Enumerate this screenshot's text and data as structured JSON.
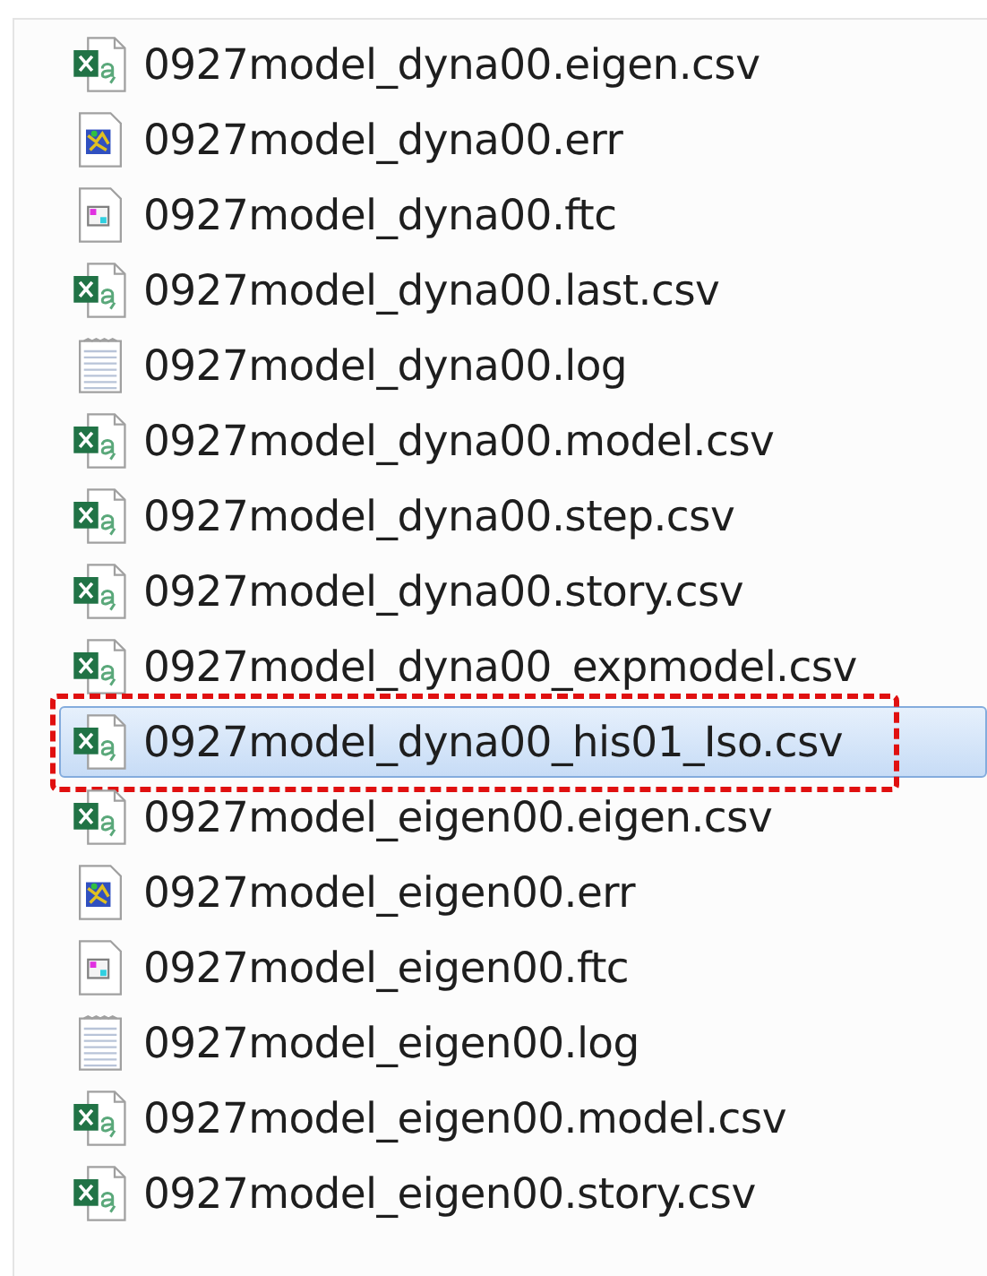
{
  "files": [
    {
      "name": "0927model_dyna00.eigen.csv",
      "kind": "sheet",
      "selected": false,
      "marked": false
    },
    {
      "name": "0927model_dyna00.err",
      "kind": "image",
      "selected": false,
      "marked": false
    },
    {
      "name": "0927model_dyna00.ftc",
      "kind": "frame",
      "selected": false,
      "marked": false
    },
    {
      "name": "0927model_dyna00.last.csv",
      "kind": "sheet",
      "selected": false,
      "marked": false
    },
    {
      "name": "0927model_dyna00.log",
      "kind": "text",
      "selected": false,
      "marked": false
    },
    {
      "name": "0927model_dyna00.model.csv",
      "kind": "sheet",
      "selected": false,
      "marked": false
    },
    {
      "name": "0927model_dyna00.step.csv",
      "kind": "sheet",
      "selected": false,
      "marked": false
    },
    {
      "name": "0927model_dyna00.story.csv",
      "kind": "sheet",
      "selected": false,
      "marked": false
    },
    {
      "name": "0927model_dyna00_expmodel.csv",
      "kind": "sheet",
      "selected": false,
      "marked": false
    },
    {
      "name": "0927model_dyna00_his01_Iso.csv",
      "kind": "sheet",
      "selected": true,
      "marked": true
    },
    {
      "name": "0927model_eigen00.eigen.csv",
      "kind": "sheet",
      "selected": false,
      "marked": false
    },
    {
      "name": "0927model_eigen00.err",
      "kind": "image",
      "selected": false,
      "marked": false
    },
    {
      "name": "0927model_eigen00.ftc",
      "kind": "frame",
      "selected": false,
      "marked": false
    },
    {
      "name": "0927model_eigen00.log",
      "kind": "text",
      "selected": false,
      "marked": false
    },
    {
      "name": "0927model_eigen00.model.csv",
      "kind": "sheet",
      "selected": false,
      "marked": false
    },
    {
      "name": "0927model_eigen00.story.csv",
      "kind": "sheet",
      "selected": false,
      "marked": false
    }
  ]
}
